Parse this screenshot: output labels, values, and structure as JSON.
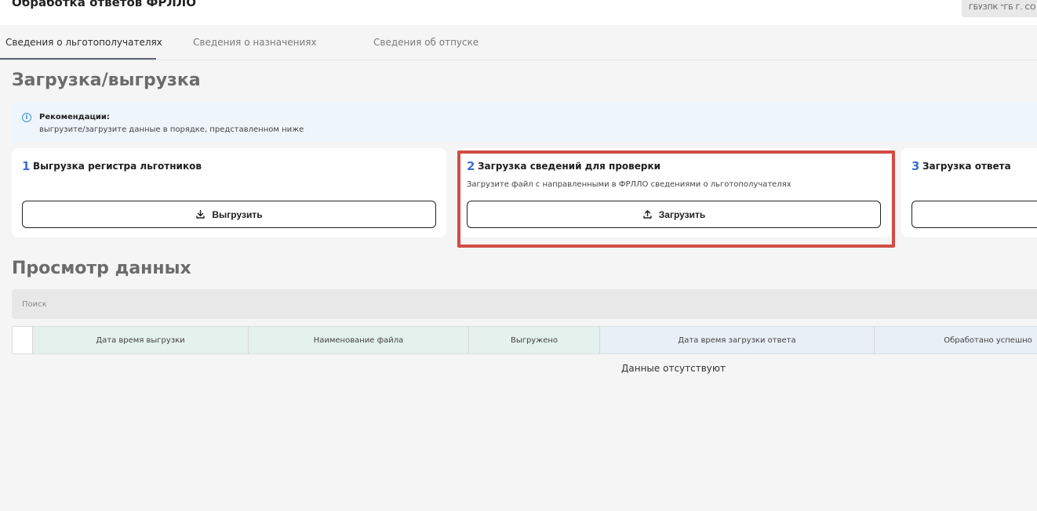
{
  "app": {
    "title": "Обработка ответов ФРЛЛО",
    "org": "ГБУЗПК \"ГБ Г. СО"
  },
  "tabs": [
    {
      "label": "Сведения о льготополучателях",
      "active": true
    },
    {
      "label": "Сведения о назначениях",
      "active": false
    },
    {
      "label": "Сведения об отпуске",
      "active": false
    }
  ],
  "upload_section": {
    "title": "Загрузка/выгрузка",
    "recommendation": {
      "title": "Рекомендации:",
      "text": "выгрузите/загрузите данные в порядке, представленном ниже",
      "icon": "info-icon"
    },
    "steps": [
      {
        "number": "1",
        "title": "Выгрузка регистра льготников",
        "description": "",
        "button_label": "Выгрузить",
        "button_icon": "download-icon"
      },
      {
        "number": "2",
        "title": "Загрузка сведений для проверки",
        "description": "Загрузите файл с направленными в ФРЛЛО сведениями о льготополучателях",
        "button_label": "Загрузить",
        "button_icon": "upload-icon"
      },
      {
        "number": "3",
        "title": "Загрузка ответа",
        "description": "",
        "button_label": "",
        "button_icon": ""
      }
    ],
    "highlight_color": "#d24c44"
  },
  "view_section": {
    "title": "Просмотр данных",
    "search": {
      "placeholder": "Поиск",
      "value": ""
    },
    "table": {
      "columns": [
        "",
        "Дата время выгрузки",
        "Наименование файла",
        "Выгружено",
        "Дата время загрузки ответа",
        "Обработано успешно"
      ],
      "rows": [],
      "empty_text": "Данные отсутствуют"
    }
  },
  "colors": {
    "accent": "#3d6fd1",
    "info_bg": "#eef5fb",
    "header_green": "#e4f1ec",
    "header_blue": "#e8eff6"
  }
}
